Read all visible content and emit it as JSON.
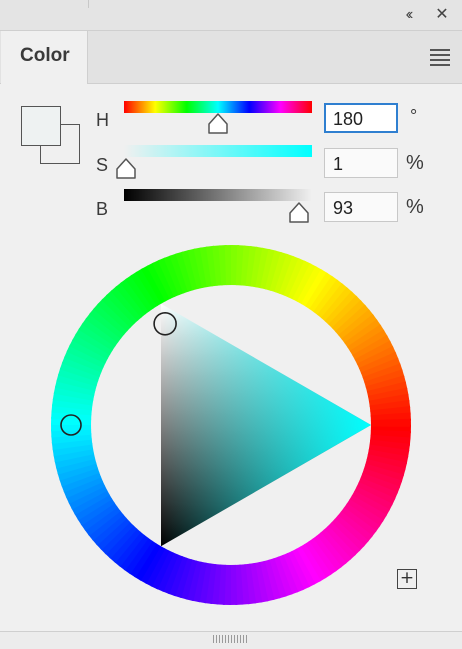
{
  "window": {
    "collapse_glyph": "‹‹",
    "close_glyph": "✕"
  },
  "panel": {
    "tab_label": "Color"
  },
  "current_color": "#eef2f2",
  "hsb": {
    "h_label": "H",
    "s_label": "S",
    "b_label": "B",
    "h_value": "180",
    "s_value": "1",
    "b_value": "93",
    "h_unit": "°",
    "s_unit": "%",
    "b_unit": "%",
    "h_fraction": 0.5,
    "s_fraction": 0.01,
    "b_fraction": 0.93
  },
  "wheel": {
    "hue_degrees": 180,
    "triangle_tip_color": "#00ffff",
    "add_glyph": "+"
  }
}
